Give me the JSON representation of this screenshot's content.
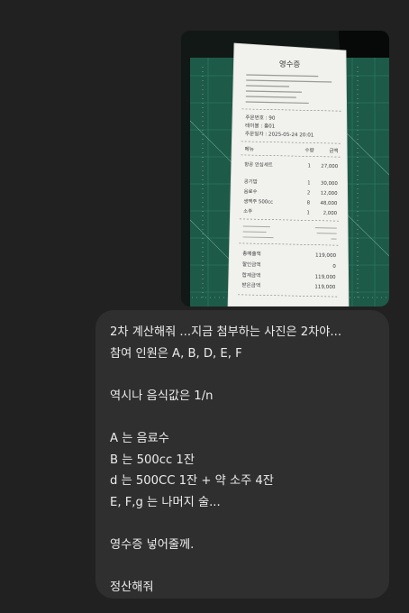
{
  "message": {
    "attachment": {
      "type": "image",
      "receipt": {
        "title": "영수증",
        "order_info": [
          "주문번호 : 90",
          "테이블 : 홀01",
          "주문일자 : 2025-05-24 20:01"
        ],
        "columns": [
          "메뉴",
          "수량",
          "금액"
        ],
        "items": [
          {
            "name": "항공 안심세트",
            "qty": "1",
            "amount": "27,000"
          },
          {
            "name": "공기밥",
            "qty": "1",
            "amount": "30,000"
          },
          {
            "name": "음료수",
            "qty": "2",
            "amount": "12,000"
          },
          {
            "name": "생맥주 500cc",
            "qty": "8",
            "amount": "48,000"
          },
          {
            "name": "소주",
            "qty": "1",
            "amount": "2,000"
          }
        ],
        "totals": [
          {
            "label": "총매출액",
            "amount": "119,000"
          },
          {
            "label": "할인금액",
            "amount": "0"
          },
          {
            "label": "합계금액",
            "amount": "119,000"
          },
          {
            "label": "받은금액",
            "amount": "119,000"
          }
        ]
      }
    },
    "lines": [
      "2차 계산해줘 ...지금 첨부하는 사진은 2차야...",
      "참여 인원은 A, B, D, E, F",
      "",
      "역시나 음식값은 1/n",
      "",
      "A 는 음료수",
      "B 는 500cc 1잔",
      "d 는 500CC 1잔 + 약 소주 4잔",
      "E, F,g 는 나머지 술...",
      "",
      "영수증 넣어줄께.",
      "",
      "정산해줘"
    ]
  },
  "colors": {
    "page_background": "#212121",
    "bubble_background": "#2f2f2f",
    "text": "#ececec"
  }
}
